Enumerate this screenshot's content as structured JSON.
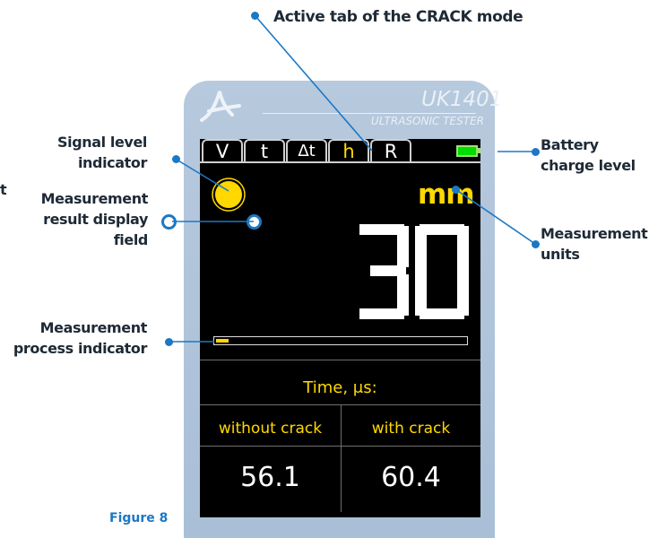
{
  "colors": {
    "accent_blue": "#1b78c4",
    "device_body": "#b0c5db",
    "screen_bg": "#000000",
    "display_yellow": "#ffd800",
    "battery_green": "#00dd00"
  },
  "device": {
    "model": "UK1401",
    "subtitle": "ULTRASONIC TESTER",
    "logo": "a-logo-icon"
  },
  "screen": {
    "tabs": [
      {
        "label": "V",
        "active": false
      },
      {
        "label": "t",
        "active": false
      },
      {
        "label": "Δt",
        "active": false
      },
      {
        "label": "h",
        "active": true
      },
      {
        "label": "R",
        "active": false
      }
    ],
    "units": "mm",
    "reading": "30",
    "progress_fraction": 0.05,
    "time_label": "Time, μs:",
    "columns": [
      "without crack",
      "with crack"
    ],
    "values": [
      "56.1",
      "60.4"
    ]
  },
  "callouts": {
    "active_tab": "Active tab of the CRACK mode",
    "signal_line1": "Signal level",
    "signal_line2": "indicator",
    "result_line1": "Measurement",
    "result_line2": "result display",
    "result_line3": "field",
    "process_line1": "Measurement",
    "process_line2": "process indicator",
    "battery_line1": "Battery",
    "battery_line2": "charge level",
    "units_line1": "Measurement",
    "units_line2": "units",
    "cut_text": "t"
  },
  "figure_caption": "Figure 8"
}
